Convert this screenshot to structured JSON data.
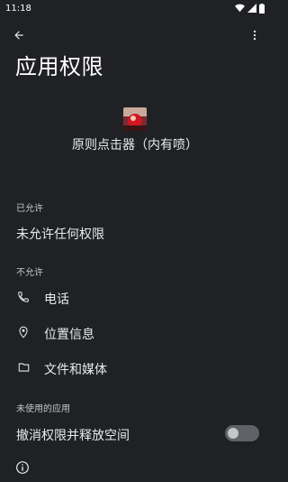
{
  "status_bar": {
    "time": "11:18",
    "icons": [
      "wifi-icon",
      "signal-icon",
      "battery-icon"
    ]
  },
  "toolbar": {
    "back_icon": "arrow-back-icon",
    "more_icon": "more-vert-icon"
  },
  "page": {
    "title": "应用权限"
  },
  "app": {
    "name": "原则点击器（内有喷）",
    "icon": "app-icon"
  },
  "sections": {
    "allowed": {
      "header": "已允许",
      "empty_text": "未允许任何权限"
    },
    "denied": {
      "header": "不允许",
      "items": [
        {
          "label": "电话",
          "icon": "phone-icon"
        },
        {
          "label": "位置信息",
          "icon": "location-pin-icon"
        },
        {
          "label": "文件和媒体",
          "icon": "folder-icon"
        }
      ]
    },
    "unused": {
      "header": "未使用的应用",
      "toggle_label": "撤消权限并释放空间",
      "toggle_on": false
    }
  },
  "footer": {
    "icon": "info-icon"
  },
  "colors": {
    "background": "#202124",
    "text_primary": "#e8eaed",
    "text_secondary": "#c4c7c5",
    "toggle_track": "#5f6368"
  }
}
